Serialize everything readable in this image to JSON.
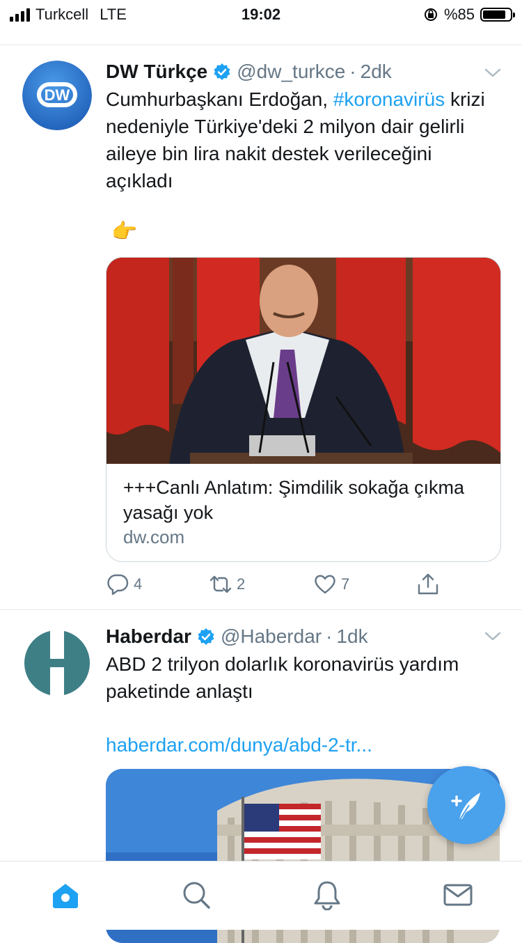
{
  "status_bar": {
    "carrier": "Turkcell",
    "network": "LTE",
    "time": "19:02",
    "battery": "%85",
    "battery_level": 0.85
  },
  "tweets": [
    {
      "name": "DW Türkçe",
      "handle": "@dw_turkce",
      "separator": "·",
      "time": "2dk",
      "text_pre": "Cumhurbaşkanı Erdoğan, ",
      "hashtag": "#koronavirüs",
      "text_post": " krizi nedeniyle Türkiye'deki 2 milyon dair gelirli aileye bin lira nakit destek verileceğini açıkladı",
      "emoji": "👉",
      "card": {
        "title": "+++Canlı Anlatım: Şimdilik sokağa çıkma yasağı yok",
        "domain": "dw.com"
      },
      "actions": {
        "reply_count": "4",
        "retweet_count": "2",
        "like_count": "7"
      },
      "avatar_color": "#2f7bd8"
    },
    {
      "name": "Haberdar",
      "handle": "@Haberdar",
      "separator": "·",
      "time": "1dk",
      "text": "ABD 2 trilyon dolarlık koronavirüs yardım paketinde anlaştı",
      "link": "haberdar.com/dunya/abd-2-tr...",
      "avatar_color": "#3e7f86"
    }
  ],
  "colors": {
    "accent": "#1da1f2",
    "secondary_text": "#657786",
    "fab": "#4aa1ec"
  },
  "tabs": [
    {
      "icon": "home-icon",
      "active": true
    },
    {
      "icon": "search-icon",
      "active": false
    },
    {
      "icon": "notifications-icon",
      "active": false
    },
    {
      "icon": "messages-icon",
      "active": false
    }
  ]
}
